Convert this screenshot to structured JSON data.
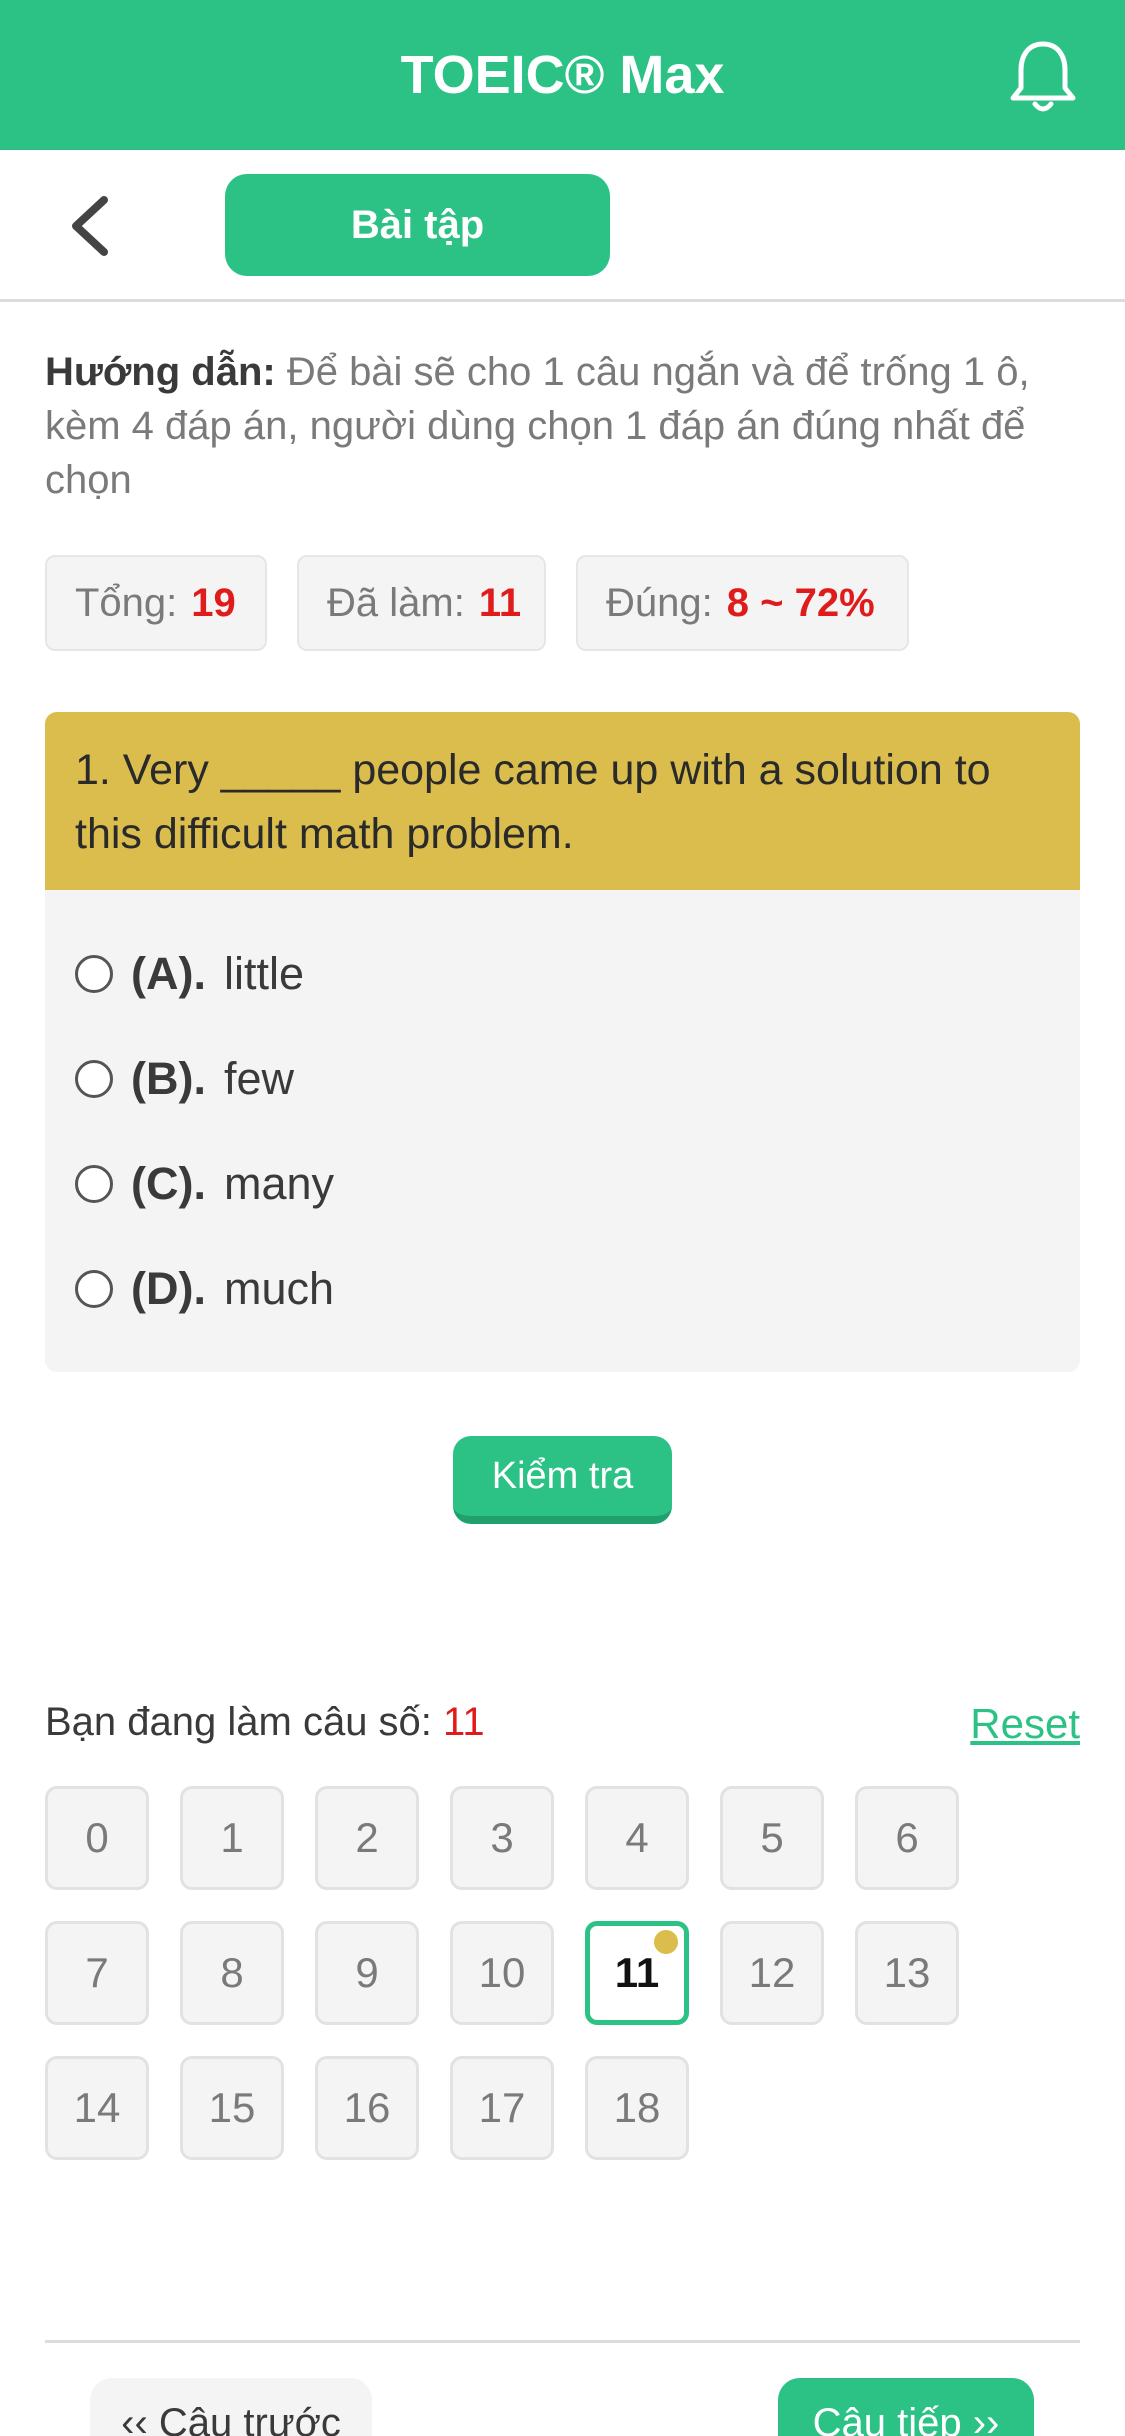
{
  "header": {
    "title": "TOEIC® Max",
    "bell_icon": "bell-icon"
  },
  "subheader": {
    "back_icon": "chevron-left-icon",
    "tab_label": "Bài tập"
  },
  "guide": {
    "label": "Hướng dẫn:",
    "text": " Để bài sẽ cho 1 câu ngắn và để trống 1 ô, kèm 4 đáp án, người dùng chọn 1 đáp án đúng nhất để chọn"
  },
  "stats": {
    "total_label": "Tổng:",
    "total_value": "19",
    "done_label": "Đã làm:",
    "done_value": "11",
    "correct_label": "Đúng:",
    "correct_value": "8 ~ 72%"
  },
  "question": {
    "text": "1. Very _____ people came up with a solution to this difficult math problem.",
    "options": [
      {
        "key": "(A).",
        "text": "little"
      },
      {
        "key": "(B).",
        "text": "few"
      },
      {
        "key": "(C).",
        "text": "many"
      },
      {
        "key": "(D).",
        "text": "much"
      }
    ]
  },
  "check_button": "Kiểm tra",
  "progress": {
    "label": "Bạn đang làm câu số:",
    "current": "11",
    "reset_label": "Reset"
  },
  "question_numbers": [
    "0",
    "1",
    "2",
    "3",
    "4",
    "5",
    "6",
    "7",
    "8",
    "9",
    "10",
    "11",
    "12",
    "13",
    "14",
    "15",
    "16",
    "17",
    "18"
  ],
  "active_number": "11",
  "nav": {
    "prev_label": "‹‹ Câu trước",
    "next_label": "Câu tiếp ››"
  },
  "colors": {
    "brand": "#2cc286",
    "question_header": "#dbbd4d",
    "highlight": "#e01b1b"
  }
}
